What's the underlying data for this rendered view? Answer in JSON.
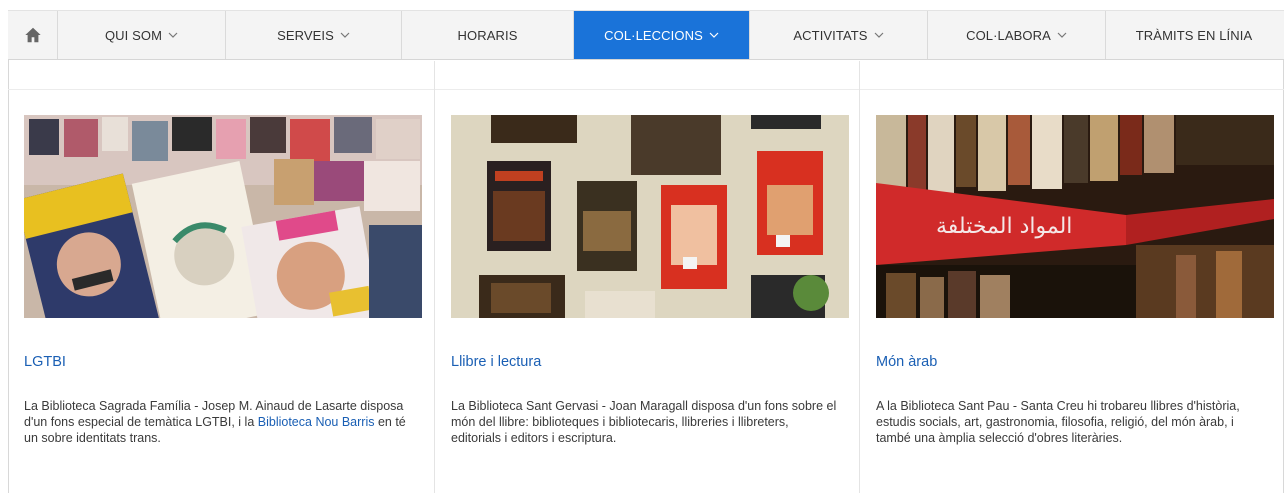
{
  "nav": {
    "home_icon": "home-icon",
    "items": [
      {
        "label": "QUI SOM",
        "dropdown": true,
        "active": false
      },
      {
        "label": "SERVEIS",
        "dropdown": true,
        "active": false
      },
      {
        "label": "HORARIS",
        "dropdown": false,
        "active": false
      },
      {
        "label": "COL·LECCIONS",
        "dropdown": true,
        "active": true
      },
      {
        "label": "ACTIVITATS",
        "dropdown": true,
        "active": false
      },
      {
        "label": "COL·LABORA",
        "dropdown": true,
        "active": false
      },
      {
        "label": "TRÀMITS EN LÍNIA",
        "dropdown": false,
        "active": false
      }
    ],
    "active_color": "#1a73d9"
  },
  "cards": [
    {
      "title": "LGTBI",
      "image": "magazine-collage-image",
      "desc_before": "La Biblioteca Sagrada Família - Josep M. Ainaud de Lasarte disposa d'un fons especial de temàtica LGTBI, i la ",
      "desc_link": "Biblioteca Nou Barris",
      "desc_after": " en té un sobre identitats trans."
    },
    {
      "title": "Llibre i lectura",
      "image": "books-on-table-image",
      "desc_before": "La Biblioteca Sant Gervasi - Joan Maragall disposa d'un fons sobre el món del llibre: biblioteques i bibliotecaris, llibreries i llibreters, editorials i editors i escriptura.",
      "desc_link": "",
      "desc_after": ""
    },
    {
      "title": "Món àrab",
      "image": "bookshelf-arabic-sign-image",
      "desc_before": "A la Biblioteca Sant Pau - Santa Creu hi trobareu llibres d'història, estudis socials, art, gastronomia, filosofia, religió, del món àrab, i també una àmplia selecció d'obres literàries.",
      "desc_link": "",
      "desc_after": ""
    }
  ],
  "colors": {
    "link": "#1a5fb4",
    "nav_bg": "#f4f4f4"
  }
}
